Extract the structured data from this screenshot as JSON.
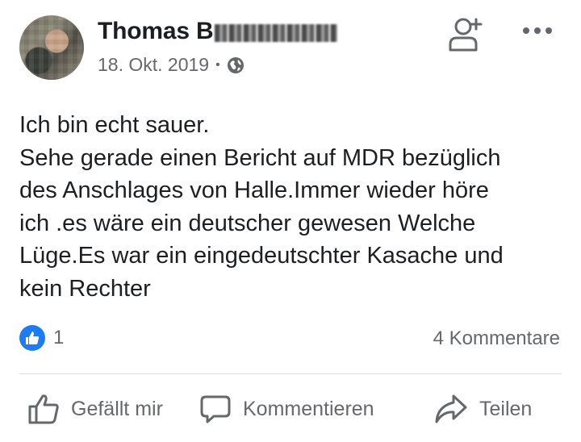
{
  "post": {
    "author_visible": "Thomas B",
    "date": "18. Okt. 2019",
    "separator": "•",
    "lines": [
      "Ich bin echt sauer.",
      "Sehe gerade einen Bericht auf MDR bezüglich",
      "des Anschlages von Halle.Immer wieder höre",
      "ich .es wäre ein deutscher gewesen Welche",
      "Lüge.Es war ein eingedeutschter Kasache und",
      "kein Rechter"
    ],
    "like_count": "1",
    "comments_count": "4 Kommentare"
  },
  "icons": {
    "privacy": "globe-icon",
    "add_friend": "add-friend-icon",
    "more": "more-options-icon",
    "reaction": "like-reaction-icon",
    "like_action": "thumbs-up-icon",
    "comment_action": "comment-icon",
    "share_action": "share-icon"
  },
  "actions": {
    "like": "Gefällt mir",
    "comment": "Kommentieren",
    "share": "Teilen"
  },
  "colors": {
    "accent": "#1d7cf2",
    "text": "#1c1e21",
    "secondary": "#65676b",
    "divider": "#dadde1"
  }
}
